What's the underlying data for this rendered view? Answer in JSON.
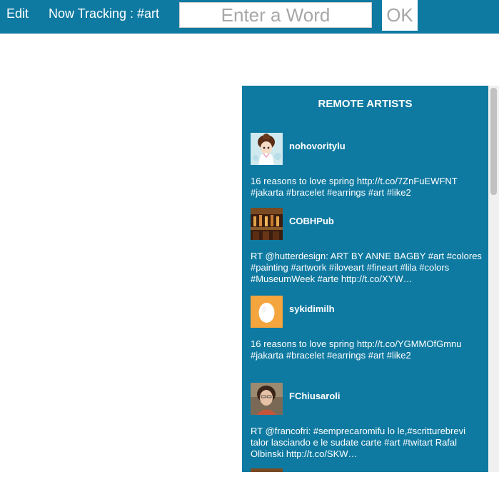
{
  "header": {
    "edit_label": "Edit",
    "tracking_label": "Now Tracking : #art",
    "word_input_placeholder": "Enter a Word",
    "word_input_value": "",
    "ok_label": "OK"
  },
  "panel": {
    "title": "REMOTE ARTISTS",
    "tweets": [
      {
        "username": "nohovoritylu",
        "text": "16 reasons to love spring http://t.co/7ZnFuEWFNT #jakarta #bracelet #earrings #art #like2"
      },
      {
        "username": "COBHPub",
        "text": "RT @hutterdesign: ART BY ANNE BAGBY #art #colores #painting #artwork #iloveart #fineart #lila #colors #MuseumWeek #arte http://t.co/XYW…"
      },
      {
        "username": "sykidimilh",
        "text": "16 reasons to love spring http://t.co/YGMMOfGmnu #jakarta #bracelet #earrings #art #like2"
      },
      {
        "username": "FChiusaroli",
        "text": "RT @francofri: #semprecaromifu lo le,#scritturebrevi talor lasciando e le sudate carte #art #twitart Rafal Olbinski http://t.co/SKW…"
      }
    ]
  },
  "colors": {
    "brand": "#0f7aa1",
    "text_on_brand": "#ffffff",
    "placeholder": "#a7a7a7"
  },
  "icons": {
    "avatars": [
      "anime-girl-avatar",
      "pub-interior-avatar",
      "default-egg-avatar",
      "woman-portrait-avatar"
    ]
  }
}
